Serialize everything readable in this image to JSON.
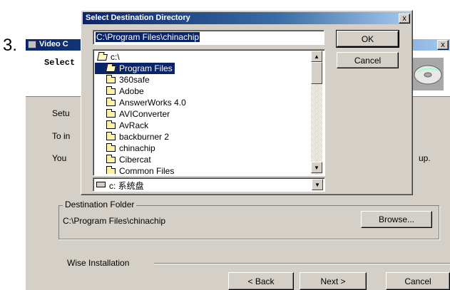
{
  "step_marker": "3.",
  "bg_window": {
    "title": "Video C",
    "header_text": "Select",
    "body_lines": [
      "Setu",
      "To in",
      "You",
      "up."
    ],
    "dest_group_label": "Destination Folder",
    "dest_path": "C:\\Program Files\\chinachip",
    "browse_label": "Browse...",
    "brand_label": "Wise Installation",
    "back_label": "< Back",
    "next_label": "Next >",
    "cancel_label": "Cancel",
    "close_glyph": "x"
  },
  "dialog": {
    "title": "Select Destination Directory",
    "close_glyph": "x",
    "path_value": "C:\\Program Files\\chinachip",
    "ok_label": "OK",
    "cancel_label": "Cancel",
    "tree": [
      {
        "label": "c:\\",
        "level": 0,
        "open": true,
        "selected": false
      },
      {
        "label": "Program Files",
        "level": 1,
        "open": true,
        "selected": true
      },
      {
        "label": "360safe",
        "level": 1,
        "open": false,
        "selected": false
      },
      {
        "label": "Adobe",
        "level": 1,
        "open": false,
        "selected": false
      },
      {
        "label": "AnswerWorks 4.0",
        "level": 1,
        "open": false,
        "selected": false
      },
      {
        "label": "AVIConverter",
        "level": 1,
        "open": false,
        "selected": false
      },
      {
        "label": "AvRack",
        "level": 1,
        "open": false,
        "selected": false
      },
      {
        "label": "backburner 2",
        "level": 1,
        "open": false,
        "selected": false
      },
      {
        "label": "chinachip",
        "level": 1,
        "open": false,
        "selected": false
      },
      {
        "label": "Cibercat",
        "level": 1,
        "open": false,
        "selected": false
      },
      {
        "label": "Common Files",
        "level": 1,
        "open": false,
        "selected": false
      }
    ],
    "drive_value": "c: 系统盘"
  }
}
